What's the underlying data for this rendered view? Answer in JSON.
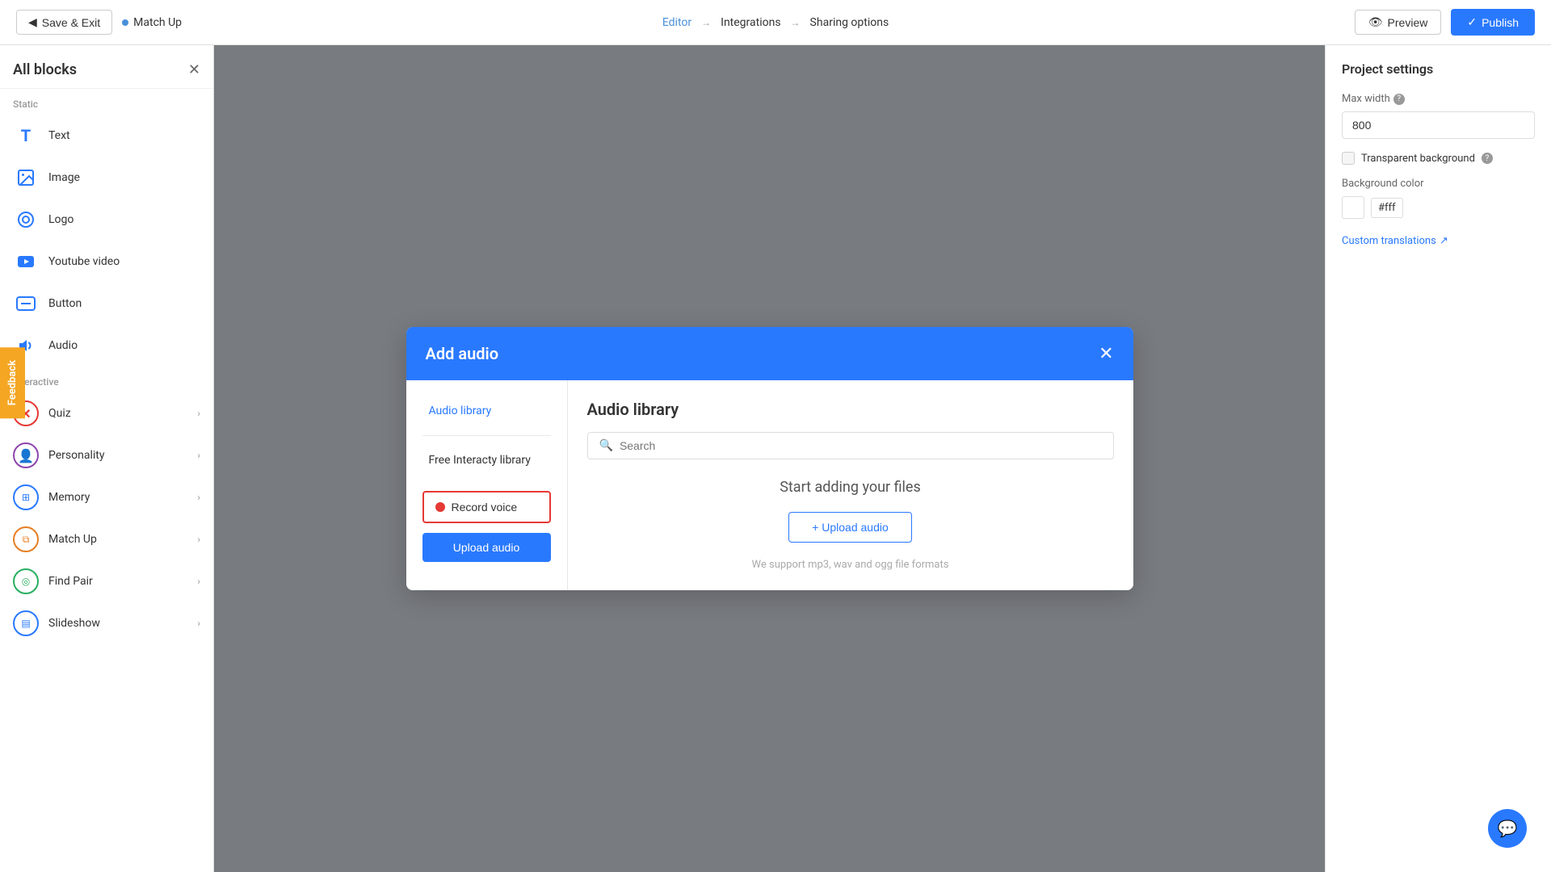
{
  "topbar": {
    "save_exit_label": "Save & Exit",
    "project_name": "Match Up",
    "editor_link": "Editor",
    "integrations_link": "Integrations",
    "sharing_options_link": "Sharing options",
    "preview_label": "Preview",
    "publish_label": "Publish"
  },
  "sidebar": {
    "title": "All blocks",
    "static_label": "Static",
    "interactive_label": "Interactive",
    "blocks": [
      {
        "id": "text",
        "label": "Text",
        "icon": "T"
      },
      {
        "id": "image",
        "label": "Image",
        "icon": "🖼"
      },
      {
        "id": "logo",
        "label": "Logo",
        "icon": "◎"
      },
      {
        "id": "youtube-video",
        "label": "Youtube video",
        "icon": "▶"
      },
      {
        "id": "button",
        "label": "Button",
        "icon": "⬜"
      },
      {
        "id": "audio",
        "label": "Audio",
        "icon": "🔊"
      }
    ],
    "interactive_blocks": [
      {
        "id": "quiz",
        "label": "Quiz"
      },
      {
        "id": "personality",
        "label": "Personality"
      },
      {
        "id": "memory",
        "label": "Memory"
      },
      {
        "id": "match-up",
        "label": "Match Up"
      },
      {
        "id": "find-pair",
        "label": "Find Pair"
      },
      {
        "id": "slideshow",
        "label": "Slideshow"
      }
    ]
  },
  "right_panel": {
    "title": "Project settings",
    "max_width_label": "Max width",
    "max_width_value": "800",
    "transparent_bg_label": "Transparent background",
    "bg_color_label": "Background color",
    "bg_color_value": "#fff",
    "custom_translations_label": "Custom translations"
  },
  "modal": {
    "title": "Add audio",
    "audio_library_tab": "Audio library",
    "free_library_tab": "Free Interacty library",
    "record_voice_label": "Record voice",
    "upload_audio_label": "Upload audio",
    "content_title": "Audio library",
    "search_placeholder": "Search",
    "empty_state_title": "Start adding your files",
    "upload_button_label": "+ Upload audio",
    "support_text": "We support mp3, wav and ogg file formats"
  },
  "feedback": {
    "label": "Feedback"
  },
  "chat": {
    "icon": "💬"
  }
}
